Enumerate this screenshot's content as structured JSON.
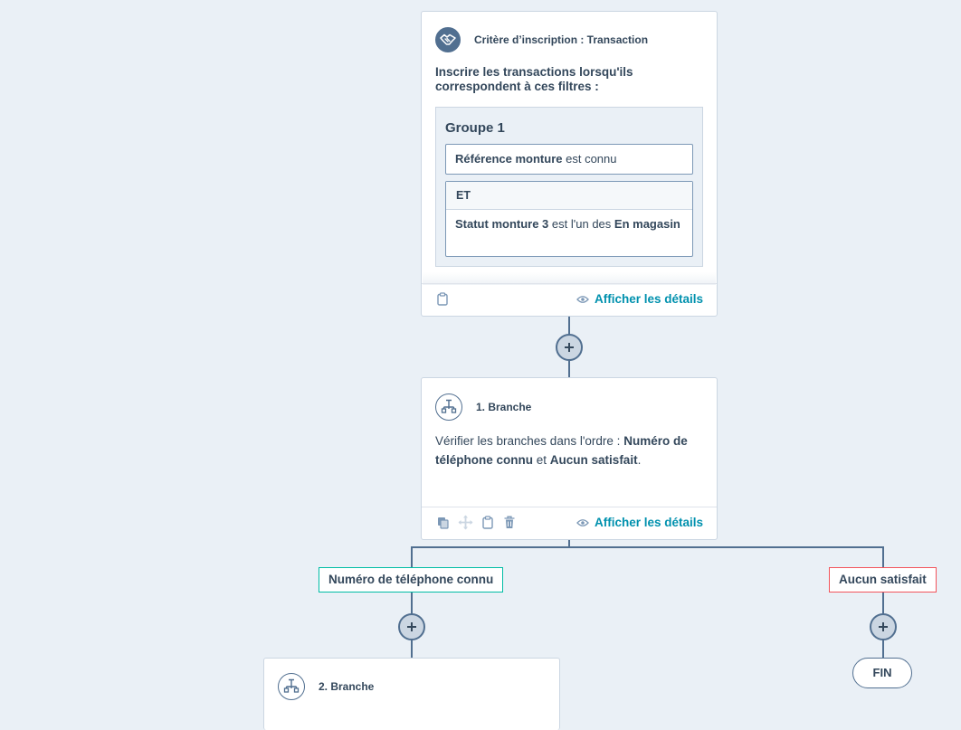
{
  "enrollment": {
    "header_title": "Critère d’inscription : Transaction",
    "intro": "Inscrire les transactions lorsqu'ils correspondent à ces filtres :",
    "group_title": "Groupe 1",
    "filter1_property": "Référence monture",
    "filter1_operator": "est connu",
    "and_label": "ET",
    "filter2_property": "Statut monture 3",
    "filter2_operator": "est l'un des",
    "filter2_value": "En magasin",
    "details_link": "Afficher les détails"
  },
  "branch1": {
    "header_title": "1. Branche",
    "desc_prefix": "Vérifier les branches dans l'ordre :",
    "branch_a": "Numéro de téléphone connu",
    "desc_and": "et",
    "branch_b": "Aucun satisfait",
    "desc_suffix": ".",
    "details_link": "Afficher les détails"
  },
  "branches": {
    "left_label": "Numéro de téléphone connu",
    "right_label": "Aucun satisfait",
    "end_label": "FIN"
  },
  "branch2": {
    "header_title": "2. Branche"
  },
  "colors": {
    "background": "#eaf0f6",
    "link": "#0091ae",
    "connector": "#516f90",
    "left_branch_border": "#00bda5",
    "right_branch_border": "#f2545b"
  },
  "icons": [
    "handshake-icon",
    "branch-icon",
    "clipboard-icon",
    "copy-icon",
    "move-icon",
    "trash-icon",
    "eye-icon",
    "plus-icon"
  ]
}
